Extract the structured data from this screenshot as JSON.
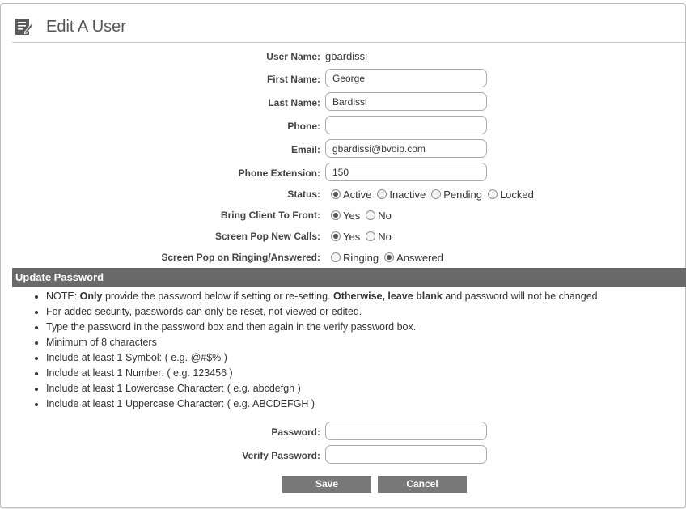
{
  "header": {
    "title": "Edit A User",
    "icon": "edit-document-icon"
  },
  "user": {
    "username_label": "User Name:",
    "username": "gbardissi",
    "first_name_label": "First Name:",
    "first_name": "George",
    "last_name_label": "Last Name:",
    "last_name": "Bardissi",
    "phone_label": "Phone:",
    "phone": "",
    "email_label": "Email:",
    "email": "gbardissi@bvoip.com",
    "extension_label": "Phone Extension:",
    "extension": "150"
  },
  "status": {
    "label": "Status:",
    "options": [
      "Active",
      "Inactive",
      "Pending",
      "Locked"
    ],
    "selected": "Active"
  },
  "bring_front": {
    "label": "Bring Client To Front:",
    "options": [
      "Yes",
      "No"
    ],
    "selected": "Yes"
  },
  "screen_pop": {
    "label": "Screen Pop New Calls:",
    "options": [
      "Yes",
      "No"
    ],
    "selected": "Yes"
  },
  "screen_pop_mode": {
    "label": "Screen Pop on Ringing/Answered:",
    "options": [
      "Ringing",
      "Answered"
    ],
    "selected": "Answered"
  },
  "password_section": {
    "title": "Update Password",
    "note_prefix": "NOTE: ",
    "note_only": "Only",
    "note_mid": " provide the password below if setting or re-setting. ",
    "note_bold2": "Otherwise, leave blank",
    "note_end": " and password will not be changed.",
    "rules": [
      "For added security, passwords can only be reset, not viewed or edited.",
      "Type the password in the password box and then again in the verify password box.",
      "Minimum of 8 characters",
      "Include at least 1 Symbol: ( e.g. @#$% )",
      "Include at least 1 Number: ( e.g. 123456 )",
      "Include at least 1 Lowercase Character: ( e.g. abcdefgh )",
      "Include at least 1 Uppercase Character: ( e.g. ABCDEFGH )"
    ],
    "password_label": "Password:",
    "password": "",
    "verify_label": "Verify Password:",
    "verify": ""
  },
  "buttons": {
    "save": "Save",
    "cancel": "Cancel"
  },
  "colors": {
    "section_bar": "#6a6a6a",
    "button": "#787878"
  }
}
